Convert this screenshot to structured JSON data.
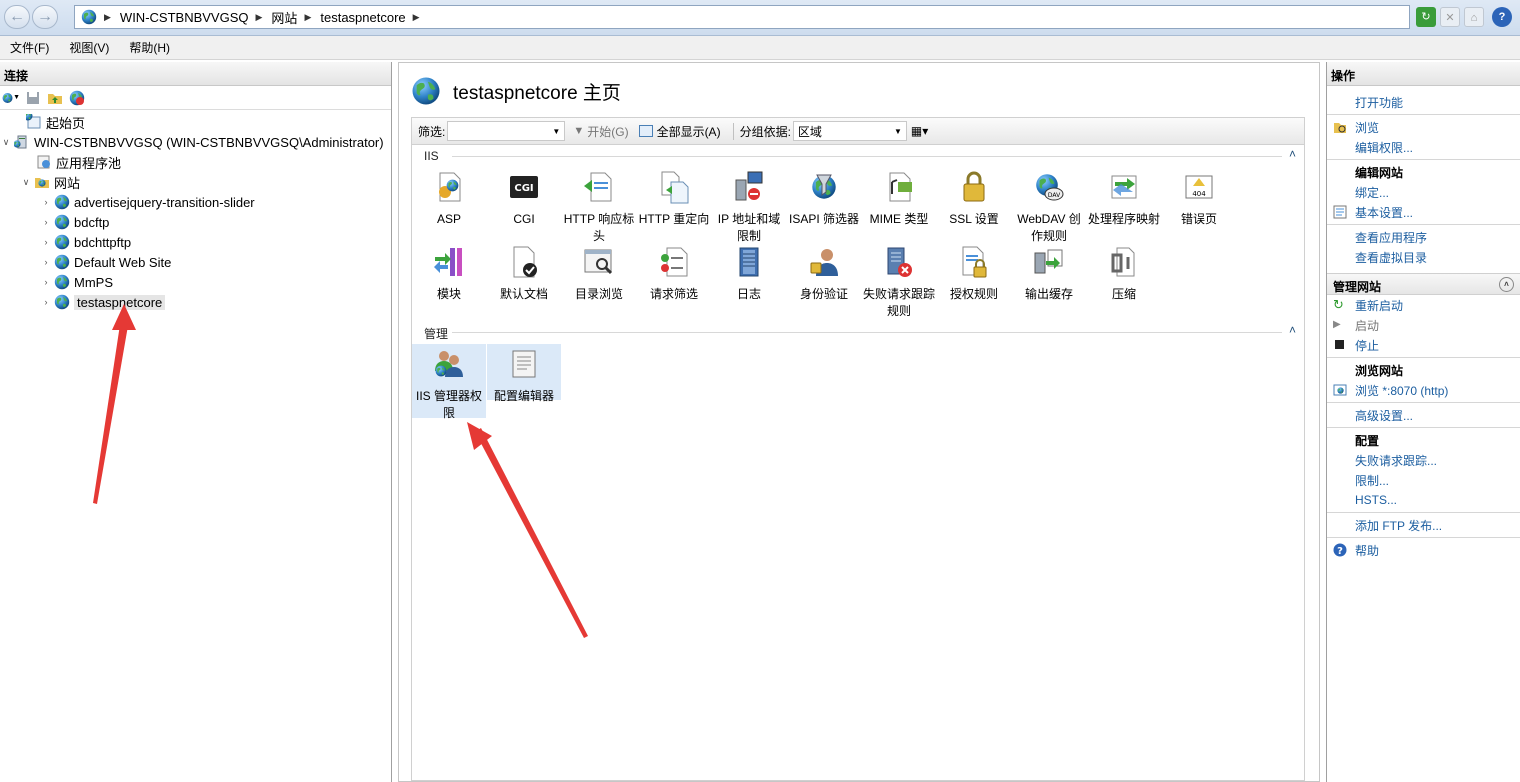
{
  "address": {
    "segments": [
      "WIN-CSTBNBVVGSQ",
      "网站",
      "testaspnetcore"
    ]
  },
  "menu": [
    "文件(F)",
    "视图(V)",
    "帮助(H)"
  ],
  "connections": {
    "title": "连接",
    "tree": {
      "start_page": "起始页",
      "server": "WIN-CSTBNBVVGSQ (WIN-CSTBNBVVGSQ\\Administrator)",
      "app_pools": "应用程序池",
      "sites": "网站",
      "site_list": [
        "advertisejquery-transition-slider",
        "bdcftp",
        "bdchttpftp",
        "Default Web Site",
        "MmPS",
        "testaspnetcore"
      ]
    }
  },
  "center": {
    "title": "testaspnetcore 主页",
    "filter_label": "筛选:",
    "start_label": "开始(G)",
    "show_all_label": "全部显示(A)",
    "group_by_label": "分组依据:",
    "group_by_value": "区域",
    "sections": {
      "iis": "IIS",
      "management": "管理"
    },
    "iis_features": [
      "ASP",
      "CGI",
      "HTTP 响应标头",
      "HTTP 重定向",
      "IP 地址和域限制",
      "ISAPI 筛选器",
      "MIME 类型",
      "SSL 设置",
      "WebDAV 创作规则",
      "处理程序映射",
      "错误页",
      "模块",
      "默认文档",
      "目录浏览",
      "请求筛选",
      "日志",
      "身份验证",
      "失败请求跟踪规则",
      "授权规则",
      "输出缓存",
      "压缩"
    ],
    "management_features": [
      "IIS 管理器权限",
      "配置编辑器"
    ],
    "cgi_icon_text": "CGI",
    "error_icon_text": "404",
    "webdav_icon_text": "DAV"
  },
  "actions": {
    "title": "操作",
    "open_feature": "打开功能",
    "explore": "浏览",
    "edit_permissions": "编辑权限...",
    "edit_site": "编辑网站",
    "bindings": "绑定...",
    "basic_settings": "基本设置...",
    "view_apps": "查看应用程序",
    "view_vdirs": "查看虚拟目录",
    "manage_site": "管理网站",
    "restart": "重新启动",
    "start": "启动",
    "stop": "停止",
    "browse_site": "浏览网站",
    "browse_link": "浏览 *:8070 (http)",
    "advanced_settings": "高级设置...",
    "config": "配置",
    "failed_request_tracing": "失败请求跟踪...",
    "limits": "限制...",
    "hsts": "HSTS...",
    "add_ftp": "添加 FTP 发布...",
    "help": "帮助"
  },
  "colors": {
    "link": "#1c5ea0",
    "arrow": "#e53935",
    "highlight": "#dbe9f8"
  }
}
